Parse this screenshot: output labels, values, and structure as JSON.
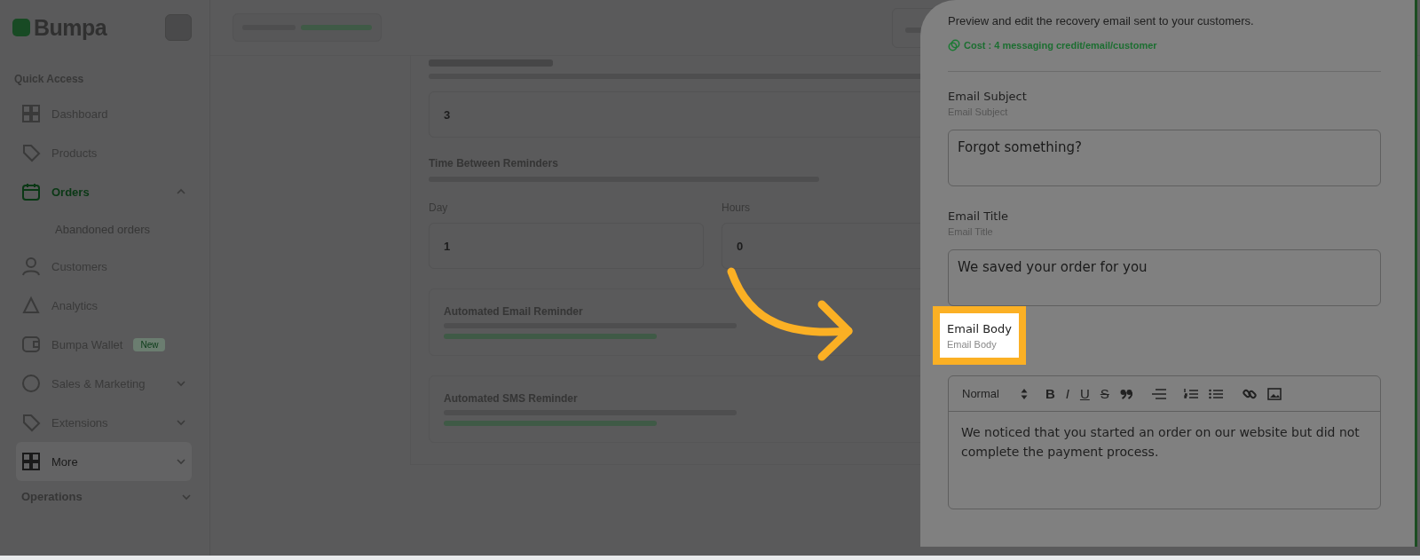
{
  "sidebar": {
    "logo": "Bumpa",
    "section": "Quick Access",
    "items": [
      {
        "label": "Dashboard",
        "selected": false
      },
      {
        "label": "Products",
        "selected": false
      },
      {
        "label": "Orders",
        "selected": true,
        "expanded": true,
        "children": [
          {
            "label": "Abandoned orders",
            "selected": false
          }
        ]
      },
      {
        "label": "Customers",
        "selected": false
      },
      {
        "label": "Analytics",
        "selected": false
      },
      {
        "label": "Bumpa Wallet",
        "selected": false,
        "badge": "New"
      },
      {
        "label": "Sales & Marketing",
        "selected": false,
        "expanded": false
      },
      {
        "label": "Extensions",
        "selected": false,
        "expanded": false
      },
      {
        "label": "More",
        "selected": false,
        "hovered": true,
        "expanded": false
      }
    ],
    "group": {
      "label": "Operations",
      "expanded": false
    }
  },
  "main": {
    "retry_value": "3",
    "time_heading": "Time Between Reminders",
    "fields": [
      {
        "label": "Day",
        "value": "1"
      },
      {
        "label": "Hours",
        "value": "0"
      }
    ],
    "cards": [
      {
        "title": "Automated Email Reminder"
      },
      {
        "title": "Automated SMS Reminder"
      }
    ]
  },
  "panel": {
    "subtitle": "Preview and edit the recovery email sent to your customers.",
    "cost": "Cost : 4 messaging credit/email/customer",
    "fields": [
      {
        "label": "Email Subject",
        "hint": "Email Subject",
        "value": "Forgot something?"
      },
      {
        "label": "Email Title",
        "hint": "Email Title",
        "value": "We saved your order for you"
      }
    ],
    "body": {
      "label": "Email Body",
      "hint": "Email Body",
      "highlighted": true,
      "toolbar": [
        {
          "kind": "select",
          "label": "Normal"
        },
        {
          "kind": "bold",
          "label": "B"
        },
        {
          "kind": "italic",
          "label": "I"
        },
        {
          "kind": "underline",
          "label": "U"
        },
        {
          "kind": "strike",
          "label": "S"
        },
        {
          "kind": "quote"
        },
        {
          "kind": "align"
        },
        {
          "kind": "ordered"
        },
        {
          "kind": "bullet"
        },
        {
          "kind": "link"
        },
        {
          "kind": "image"
        }
      ],
      "text": "We noticed that you started an order on our website but did not complete the payment process."
    }
  }
}
